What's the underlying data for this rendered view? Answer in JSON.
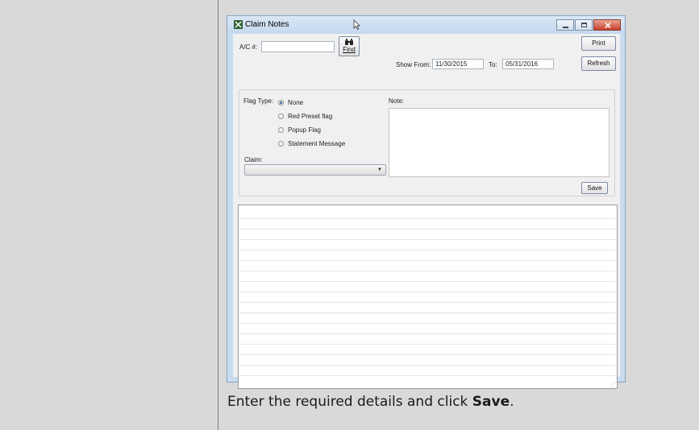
{
  "caption": {
    "text": "Enter the required details and click ",
    "bold": "Save",
    "end": "."
  },
  "window": {
    "title": "Claim Notes",
    "controls": {
      "minimize": "minimize-icon",
      "maximize": "maximize-icon",
      "close": "close-icon"
    }
  },
  "form": {
    "ac_label": "A/C #:",
    "ac_value": "",
    "find_label": "Find",
    "print_label": "Print",
    "refresh_label": "Refresh",
    "show_from_label": "Show From:",
    "show_from_value": "11/30/2015",
    "to_label": "To:",
    "to_value": "05/31/2016",
    "flag_type_label": "Flag Type:",
    "flag_options": [
      {
        "label": "None",
        "selected": true
      },
      {
        "label": "Red Preset flag",
        "selected": false
      },
      {
        "label": "Popup Flag",
        "selected": false
      },
      {
        "label": "Statement Message",
        "selected": false
      }
    ],
    "note_label": "Note:",
    "note_value": "",
    "claim_label": "Claim:",
    "claim_value": "",
    "save_label": "Save"
  },
  "colors": {
    "accent": "#3a5fa0",
    "titlebar": "#c5d8ee",
    "close": "#c6402b"
  }
}
